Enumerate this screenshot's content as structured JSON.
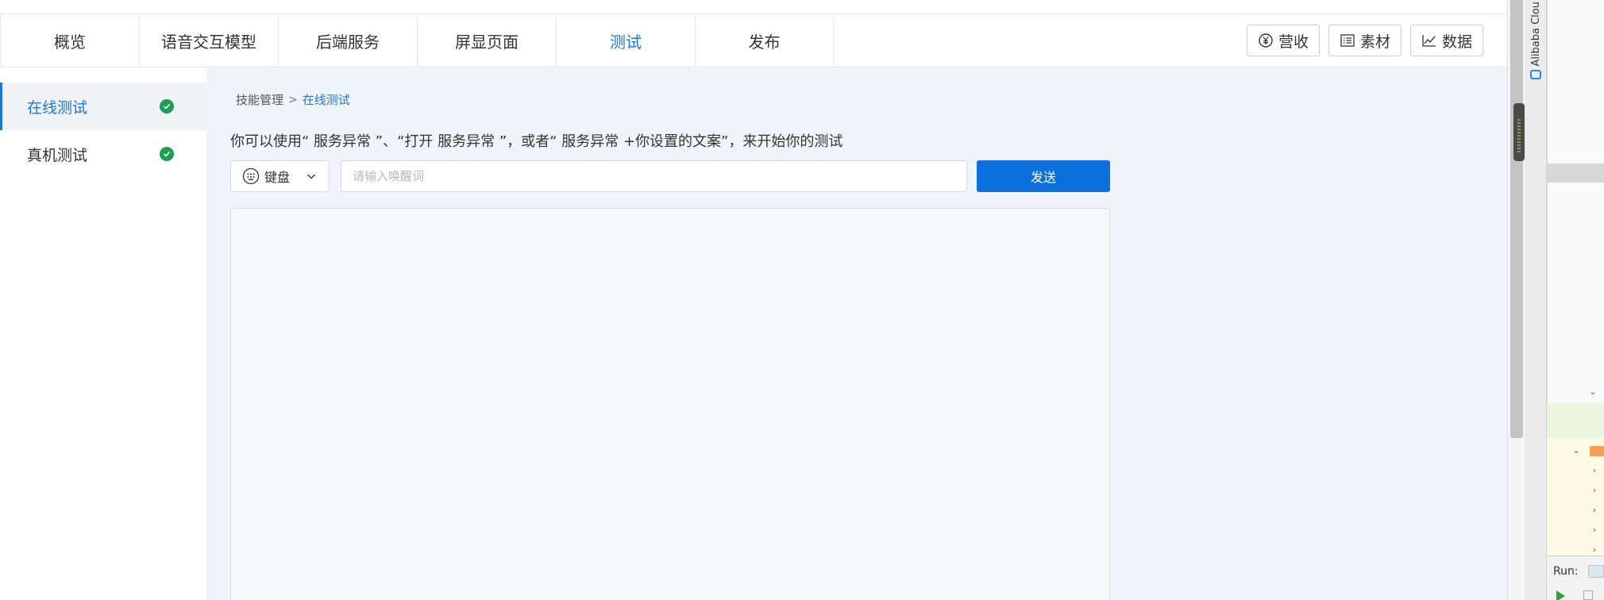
{
  "nav": {
    "tabs": [
      {
        "label": "概览"
      },
      {
        "label": "语音交互模型"
      },
      {
        "label": "后端服务"
      },
      {
        "label": "屏显页面"
      },
      {
        "label": "测试"
      },
      {
        "label": "发布"
      }
    ],
    "active_tab": "测试",
    "actions": [
      {
        "label": "营收",
        "icon": "yen-circle-icon"
      },
      {
        "label": "素材",
        "icon": "material-list-icon"
      },
      {
        "label": "数据",
        "icon": "line-chart-icon"
      }
    ]
  },
  "sidebar": {
    "items": [
      {
        "label": "在线测试",
        "status": "check-circle-icon"
      },
      {
        "label": "真机测试",
        "status": "check-circle-icon"
      }
    ],
    "active_item": "在线测试"
  },
  "breadcrumb": {
    "parent": "技能管理",
    "separator": ">",
    "current": "在线测试"
  },
  "main": {
    "instruction": "你可以使用“ 服务异常 ”、“打开 服务异常 ”，或者“ 服务异常 +你设置的文案”，来开始你的测试",
    "mode_select": {
      "value": "键盘",
      "icon": "keyboard-icon"
    },
    "wake_input": {
      "value": "",
      "placeholder": "请输入唤醒词"
    },
    "send_label": "发送"
  },
  "ide": {
    "plugin_tab_label": "Alibaba Clou",
    "run_label": "Run:"
  },
  "colors": {
    "accent": "#1f76d2",
    "send_button": "#0b6fdc",
    "success": "#1f9d55",
    "main_bg": "#eff4fa"
  }
}
